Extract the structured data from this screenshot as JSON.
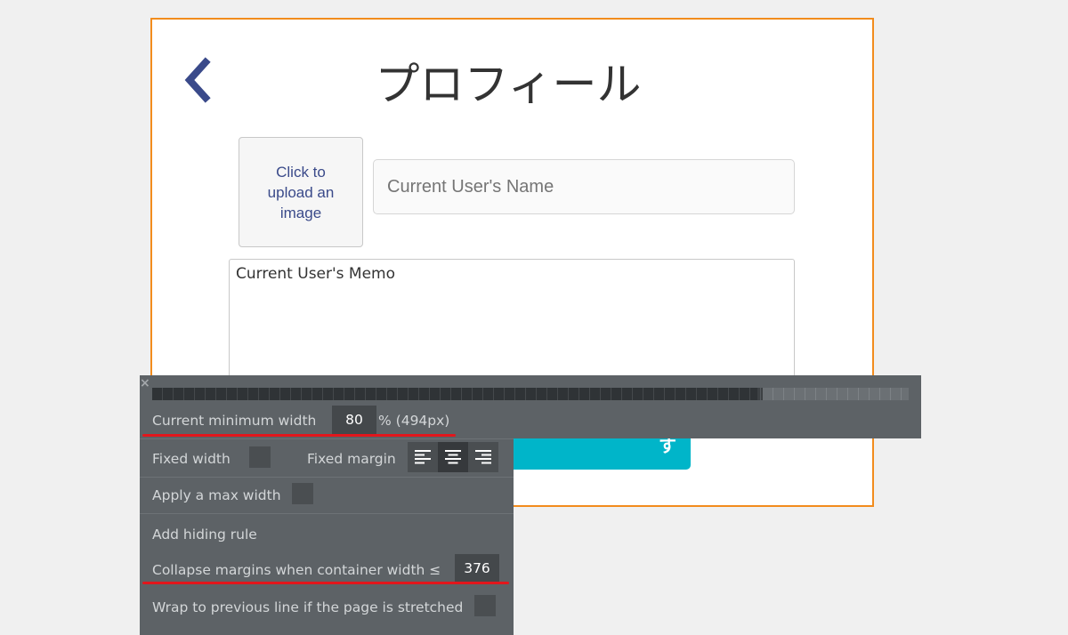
{
  "page": {
    "title": "プロフィール",
    "upload_label": "Click to upload an image",
    "name_placeholder": "Current User's Name",
    "memo_value": "Current User's Memo",
    "save_button_label": "する"
  },
  "panel": {
    "close_glyph": "×",
    "min_width": {
      "label": "Current minimum width",
      "value": "80",
      "suffix": "% (494px)"
    },
    "ruler_fill_fraction": 0.8,
    "fixed_width": {
      "label": "Fixed width",
      "checked": false
    },
    "fixed_margin": {
      "label": "Fixed margin",
      "options": [
        "align-left",
        "align-center",
        "align-right"
      ],
      "selected": "align-center"
    },
    "max_width": {
      "label": "Apply a max width",
      "checked": false
    },
    "hiding_rule": {
      "label": "Add hiding rule"
    },
    "collapse_margins": {
      "label": "Collapse margins when container width ≤",
      "value": "376"
    },
    "wrap": {
      "label": "Wrap to previous line if the page is stretched",
      "checked": false
    }
  },
  "colors": {
    "page_border": "#f28c1d",
    "accent_button": "#00b5c9",
    "panel_bg": "#5d6266",
    "highlight_underline": "#e2161c",
    "back_arrow": "#3a4a8a"
  }
}
